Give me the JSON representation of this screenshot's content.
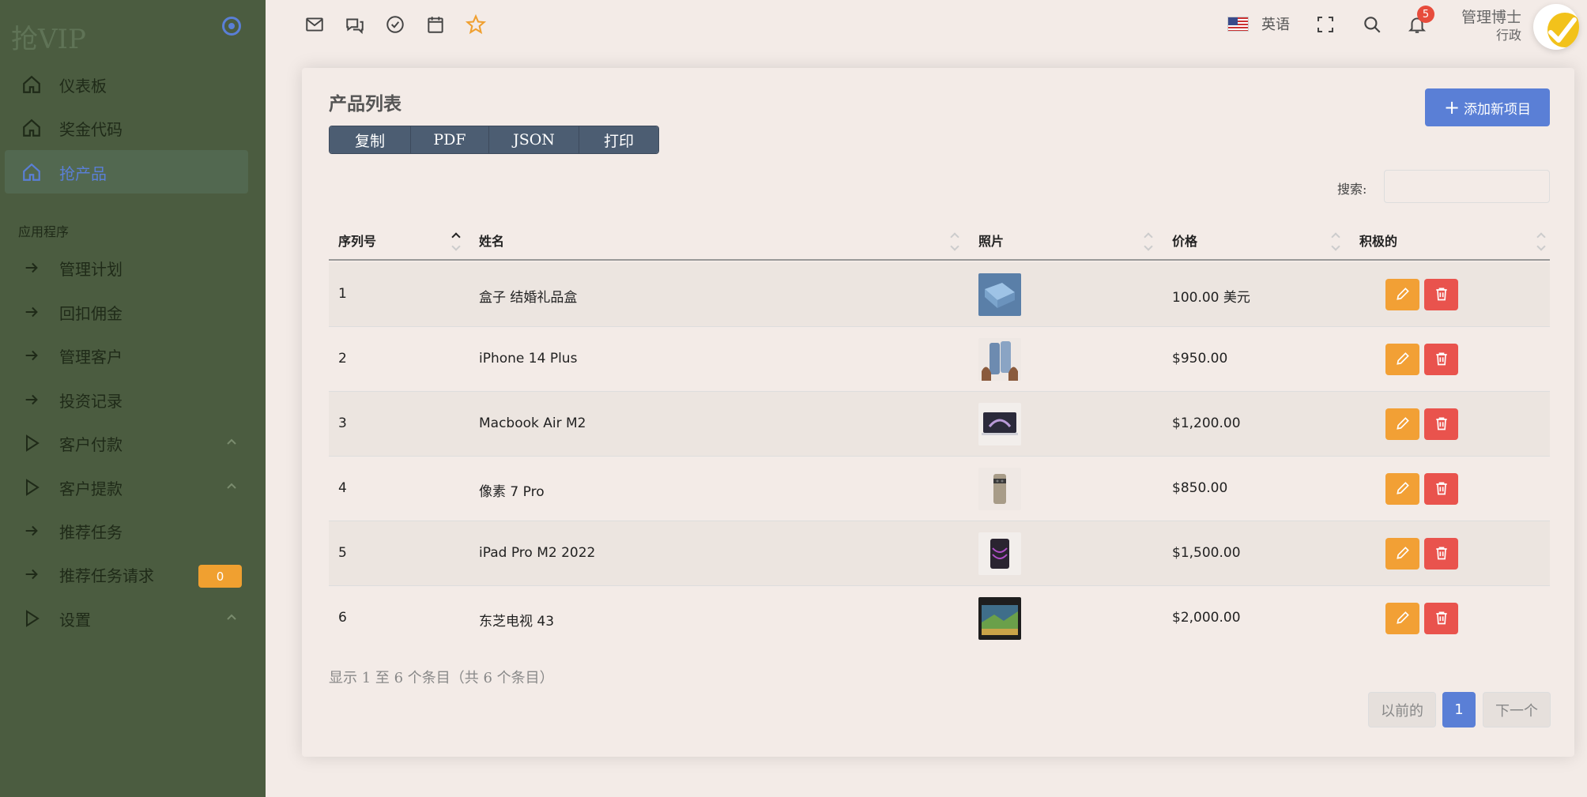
{
  "app": {
    "logo": "抢VIP"
  },
  "sidebar": {
    "items": [
      {
        "label": "仪表板"
      },
      {
        "label": "奖金代码"
      },
      {
        "label": "抢产品"
      }
    ],
    "section_title": "应用程序",
    "apps": [
      {
        "label": "管理计划"
      },
      {
        "label": "回扣佣金"
      },
      {
        "label": "管理客户"
      },
      {
        "label": "投资记录"
      },
      {
        "label": "客户付款"
      },
      {
        "label": "客户提款"
      },
      {
        "label": "推荐任务"
      },
      {
        "label": "推荐任务请求",
        "badge": "0"
      },
      {
        "label": "设置"
      }
    ]
  },
  "topbar": {
    "language": "英语",
    "notification_count": "5",
    "user_name": "管理博士",
    "user_role": "行政"
  },
  "card": {
    "title": "产品列表",
    "export_buttons": [
      "复制",
      "PDF",
      "JSON",
      "打印"
    ],
    "add_button": "添加新项目",
    "search_label": "搜索:",
    "columns": [
      "序列号",
      "姓名",
      "照片",
      "价格",
      "积极的"
    ],
    "rows": [
      {
        "id": "1",
        "name": "盒子 结婚礼品盒",
        "price": "100.00 美元"
      },
      {
        "id": "2",
        "name": "iPhone 14 Plus",
        "price": "$950.00"
      },
      {
        "id": "3",
        "name": "Macbook Air M2",
        "price": "$1,200.00"
      },
      {
        "id": "4",
        "name": "像素 7 Pro",
        "price": "$850.00"
      },
      {
        "id": "5",
        "name": "iPad Pro M2 2022",
        "price": "$1,500.00"
      },
      {
        "id": "6",
        "name": "东芝电视 43",
        "price": "$2,000.00"
      }
    ],
    "footer_info": "显示 1 至 6 个条目（共 6 个条目）",
    "pagination": {
      "prev": "以前的",
      "current": "1",
      "next": "下一个"
    }
  },
  "colors": {
    "sidebar_bg": "#4b5c40",
    "accent": "#5a7fd6",
    "edit": "#f2a035",
    "delete": "#e9534d",
    "badge": "#f0a030"
  },
  "icons": {
    "nav": [
      "home-icon",
      "arrow-right-icon",
      "triangle-right-icon",
      "chevron-up-icon"
    ],
    "topbar": [
      "mail-icon",
      "chat-icon",
      "check-circle-icon",
      "calendar-icon",
      "star-icon",
      "fullscreen-icon",
      "search-icon",
      "bell-icon"
    ],
    "actions": [
      "pencil-icon",
      "trash-icon"
    ]
  }
}
